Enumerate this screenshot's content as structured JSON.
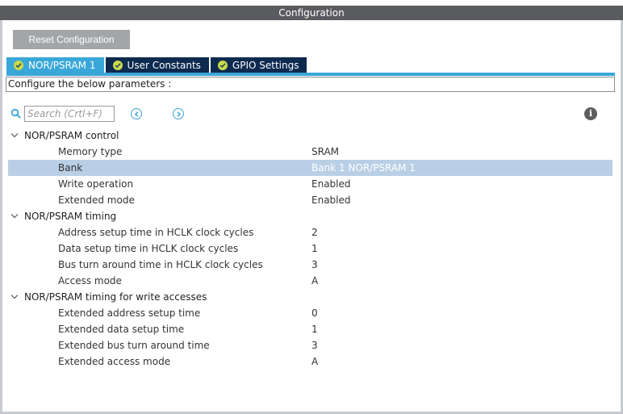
{
  "window": {
    "title": "Configuration"
  },
  "toolbar": {
    "reset_label": "Reset Configuration"
  },
  "tabs": [
    {
      "label": "NOR/PSRAM 1",
      "active": true,
      "icon": "check-circle-icon"
    },
    {
      "label": "User Constants",
      "active": false,
      "icon": "check-circle-icon"
    },
    {
      "label": "GPIO Settings",
      "active": false,
      "icon": "check-circle-icon"
    }
  ],
  "description": "Configure the below parameters :",
  "search": {
    "placeholder": "Search (Crtl+F)",
    "value": ""
  },
  "groups": [
    {
      "title": "NOR/PSRAM control",
      "params": [
        {
          "name": "Memory type",
          "value": "SRAM"
        },
        {
          "name": "Bank",
          "value": "Bank 1 NOR/PSRAM 1"
        },
        {
          "name": "Write operation",
          "value": "Enabled"
        },
        {
          "name": "Extended mode",
          "value": "Enabled"
        }
      ]
    },
    {
      "title": "NOR/PSRAM timing",
      "params": [
        {
          "name": "Address setup time in HCLK clock cycles",
          "value": "2"
        },
        {
          "name": "Data setup time in HCLK clock cycles",
          "value": "1"
        },
        {
          "name": "Bus turn around time in HCLK clock cycles",
          "value": "3"
        },
        {
          "name": "Access mode",
          "value": "A"
        }
      ]
    },
    {
      "title": "NOR/PSRAM timing for write accesses",
      "params": [
        {
          "name": "Extended address setup time",
          "value": "0"
        },
        {
          "name": "Extended data setup time",
          "value": "1"
        },
        {
          "name": "Extended bus turn around time",
          "value": "3"
        },
        {
          "name": "Extended access mode",
          "value": "A"
        }
      ]
    }
  ],
  "colors": {
    "accent": "#3aa7d9",
    "tab_inactive": "#0d2a4f",
    "title_bar": "#5a5b5e",
    "selection": "#b9cfe5",
    "check": "#c9d94c"
  }
}
